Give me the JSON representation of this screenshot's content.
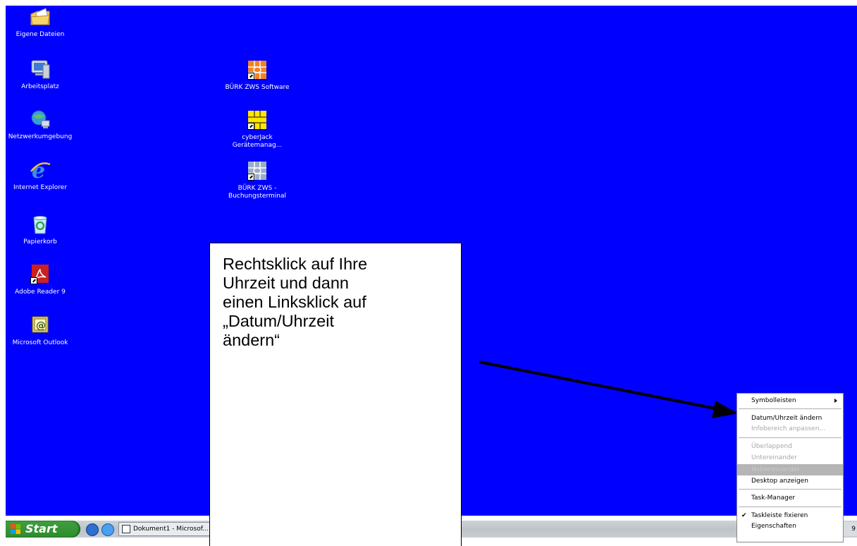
{
  "desktop": {
    "icons": [
      {
        "label": "Eigene Dateien",
        "icon": "folder-documents-icon"
      },
      {
        "label": "Arbeitsplatz",
        "icon": "my-computer-icon"
      },
      {
        "label": "Netzwerkumgebung",
        "icon": "network-icon"
      },
      {
        "label": "Internet Explorer",
        "icon": "internet-explorer-icon"
      },
      {
        "label": "Papierkorb",
        "icon": "recycle-bin-icon"
      },
      {
        "label": "Adobe Reader 9",
        "icon": "adobe-reader-icon"
      },
      {
        "label": "Microsoft Outlook",
        "icon": "outlook-icon"
      },
      {
        "label": "BÜRK ZWS Software",
        "icon": "chip-card-icon"
      },
      {
        "label_line1": "cyberJack",
        "label_line2": "Gerätemanag...",
        "icon": "chip-card-yellow-icon"
      },
      {
        "label_line1": "BÜRK ZWS -",
        "label_line2": "Buchungsterminal",
        "icon": "chip-card-gray-icon"
      }
    ]
  },
  "callout": {
    "line1": "Rechtsklick auf Ihre",
    "line2": "Uhrzeit und dann",
    "line3": "einen Linksklick auf",
    "line4": "„Datum/Uhrzeit",
    "line5": "ändern“"
  },
  "context_menu": {
    "items": [
      {
        "label": "Symbolleisten",
        "state": "enabled",
        "submenu": true
      },
      {
        "label": "Datum/Uhrzeit ändern",
        "state": "enabled"
      },
      {
        "label": "Infobereich anpassen...",
        "state": "disabled"
      },
      {
        "label": "Überlappend",
        "state": "disabled"
      },
      {
        "label": "Untereinander",
        "state": "disabled"
      },
      {
        "label": "Nebeneinander",
        "state": "highlighted"
      },
      {
        "label": "Desktop anzeigen",
        "state": "enabled"
      },
      {
        "label": "Task-Manager",
        "state": "enabled"
      },
      {
        "label": "Taskleiste fixieren",
        "state": "checked"
      },
      {
        "label": "Eigenschaften",
        "state": "enabled"
      }
    ],
    "check_glyph": "✔"
  },
  "taskbar": {
    "start_label": "Start",
    "quicklaunch": [
      "show-desktop-icon",
      "internet-explorer-icon"
    ],
    "task_button_label": "Dokument1 - Microsof...",
    "clock_fragment": "9"
  },
  "colors": {
    "desktop_bg": "#0000fe",
    "start_green": "#3fa03f"
  }
}
